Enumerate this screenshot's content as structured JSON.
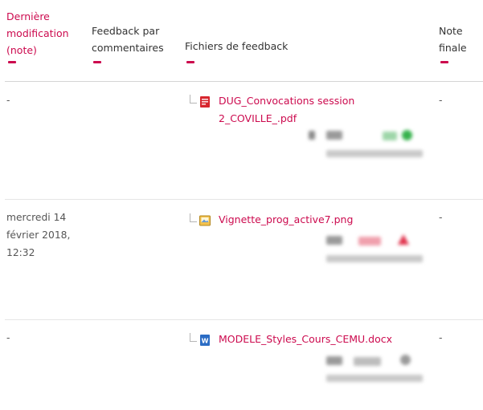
{
  "headers": {
    "last_modified": [
      "Dernière",
      "modification",
      "(note)"
    ],
    "comment_feedback": [
      "Feedback par",
      "commentaires"
    ],
    "feedback_files": [
      "Fichiers de feedback"
    ],
    "final_grade": [
      "Note",
      "finale"
    ]
  },
  "rows": [
    {
      "last_modified": "-",
      "file_name_line1": "DUG_Convocations session",
      "file_name_line2": "2_COVILLE_.pdf",
      "file_icon": "pdf-icon",
      "final_grade": "-"
    },
    {
      "last_modified_line1": "mercredi 14",
      "last_modified_line2": "février 2018,",
      "last_modified_line3": "12:32",
      "file_name_line1": "Vignette_prog_active7.png",
      "file_icon": "image-icon",
      "final_grade": "-"
    },
    {
      "last_modified": "-",
      "file_name_line1": "MODELE_Styles_Cours_CEMU.docx",
      "file_icon": "word-doc-icon",
      "final_grade": "-"
    }
  ],
  "colors": {
    "accent": "#cc0a4e",
    "status_ok": "#37b24d",
    "status_error": "#e0314b",
    "status_neutral": "#9a9a9a"
  }
}
